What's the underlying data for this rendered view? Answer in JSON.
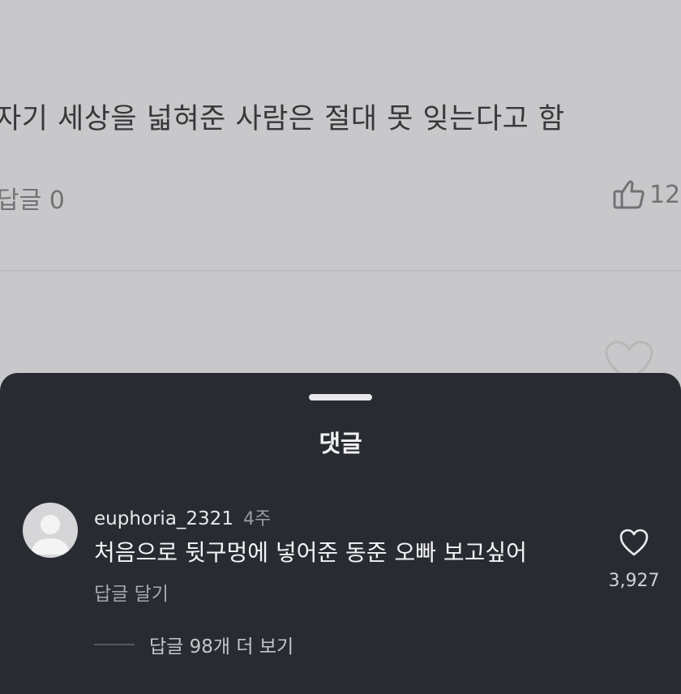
{
  "background": {
    "post_text": "자기 세상을 넓혀준 사람은 절대 못 잊는다고 함",
    "reply_count": "답글 0",
    "like_count": "12"
  },
  "sheet": {
    "title": "댓글",
    "comment": {
      "username": "euphoria_2321",
      "time_ago": "4주",
      "text": "처음으로 뒷구멍에 넣어준 동준 오빠 보고싶어",
      "reply_action": "답글 달기",
      "like_count": "3,927",
      "more_replies": "답글 98개 더 보기"
    }
  },
  "icons": {
    "avatar": "default-avatar-icon",
    "like": "heart-outline-icon",
    "thumbs": "thumbs-up-icon"
  },
  "colors": {
    "sheet_bg": "#282b31",
    "page_bg": "#d5d5d7"
  }
}
